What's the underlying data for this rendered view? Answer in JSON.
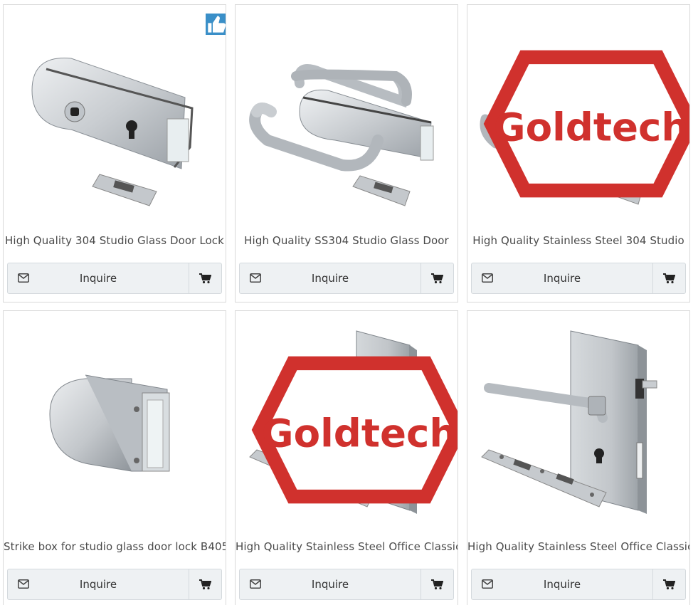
{
  "products": [
    {
      "title": "High Quality 304 Studio Glass Door Lock",
      "inquire_label": "Inquire",
      "image": "glass-door-lock-with-strike-plate",
      "badge": "thumbs-up-icon"
    },
    {
      "title": "High Quality SS304 Studio Glass Door",
      "inquire_label": "Inquire",
      "image": "glass-door-lock-with-u-handles",
      "badge": ""
    },
    {
      "title": "High Quality Stainless Steel 304 Studio",
      "inquire_label": "Inquire",
      "image": "glass-door-lock-with-u-handles-keyhole",
      "badge": "goldtech-logo"
    },
    {
      "title": "Strike box for studio glass door lock B405",
      "inquire_label": "Inquire",
      "image": "strike-box",
      "badge": ""
    },
    {
      "title": "High Quality Stainless Steel Office Classic",
      "inquire_label": "Inquire",
      "image": "office-lock-with-thumbturn",
      "badge": "goldtech-logo"
    },
    {
      "title": "High Quality Stainless Steel Office Classic",
      "inquire_label": "Inquire",
      "image": "office-lock-with-lever-handle",
      "badge": ""
    }
  ],
  "logo_text": "Goldtech",
  "colors": {
    "accent_blue": "#3a8fc8",
    "logo_red": "#d0312d",
    "button_bg": "#eef1f3",
    "card_border": "#d9d9d9"
  }
}
